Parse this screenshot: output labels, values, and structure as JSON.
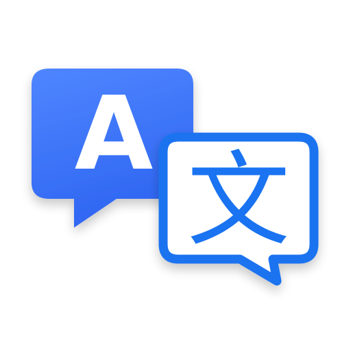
{
  "icon": {
    "name": "translate-icon",
    "source_glyph": "A",
    "target_glyph": "文",
    "colors": {
      "back_bubble_top": "#4f86ff",
      "back_bubble_bottom": "#2f66f2",
      "front_bubble_stroke": "#1a73f0",
      "front_bubble_fill": "#ffffff",
      "glyph_on_blue": "#ffffff",
      "glyph_on_white": "#1a73f0",
      "background": "#ffffff"
    }
  }
}
